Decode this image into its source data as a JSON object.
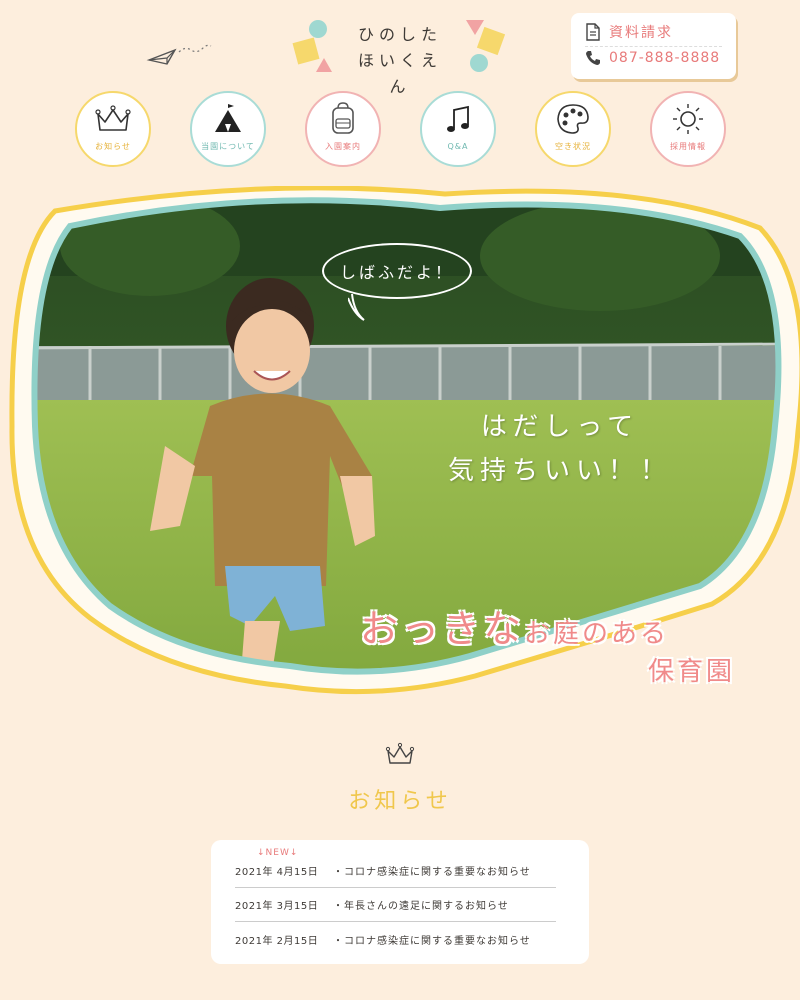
{
  "header": {
    "logo_line1": "ひのした",
    "logo_line2": "ほいくえん",
    "contact": {
      "request_label": "資料請求",
      "phone": "087-888-8888"
    }
  },
  "nav": {
    "items": [
      {
        "label": "お知らせ",
        "icon": "crown-icon"
      },
      {
        "label": "当園について",
        "icon": "tent-icon"
      },
      {
        "label": "入園案内",
        "icon": "backpack-icon"
      },
      {
        "label": "Q&A",
        "icon": "music-note-icon"
      },
      {
        "label": "空き状況",
        "icon": "palette-icon"
      },
      {
        "label": "採用情報",
        "icon": "sun-icon"
      }
    ]
  },
  "hero": {
    "speech_bubble": "しばふだよ！",
    "copy_line1": "はだしって",
    "copy_line2": "気持ちいい！！",
    "tagline_big": "おっきな",
    "tagline_mid": "お庭のある",
    "tagline_line2": "保育園"
  },
  "news": {
    "title": "お知らせ",
    "new_tag": "↓NEW↓",
    "items": [
      {
        "date": "2021年 4月15日",
        "title": "・コロナ感染症に関する重要なお知らせ"
      },
      {
        "date": "2021年 3月15日",
        "title": "・年長さんの遠足に関するお知らせ"
      },
      {
        "date": "2021年 2月15日",
        "title": "・コロナ感染症に関する重要なお知らせ"
      }
    ]
  },
  "colors": {
    "background": "#fdeedd",
    "accent_pink": "#f08a8a",
    "accent_yellow": "#f6d86c",
    "accent_teal": "#a9dcd6"
  }
}
